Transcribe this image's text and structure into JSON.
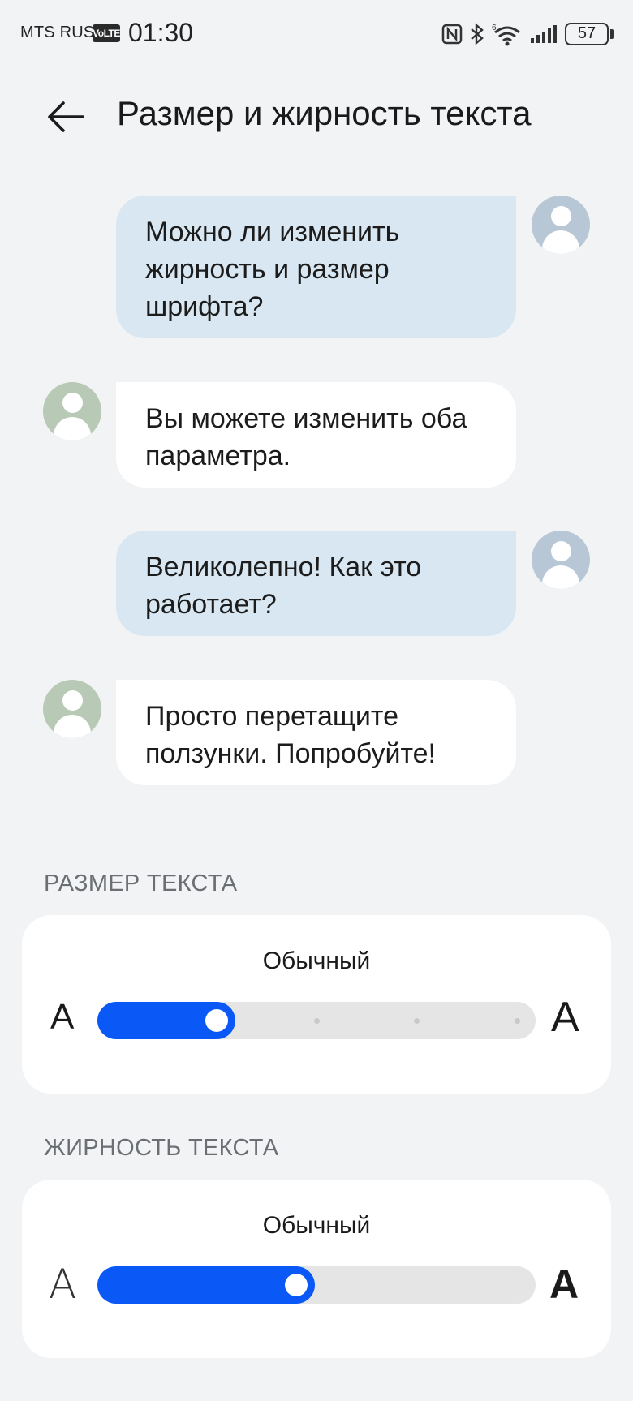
{
  "status_bar": {
    "carrier": "MTS RUS",
    "network_badge": "VoLTE",
    "time": "01:30",
    "battery_level": "57",
    "icons": [
      "nfc-icon",
      "bluetooth-icon",
      "wifi-6-icon",
      "signal-icon",
      "battery-icon"
    ]
  },
  "header": {
    "back_icon": "arrow-left-icon",
    "title": "Размер и жирность текста"
  },
  "chat": [
    {
      "side": "sent",
      "text": "Можно ли изменить жирность и размер шрифта?"
    },
    {
      "side": "received",
      "text": "Вы можете изменить оба параметра."
    },
    {
      "side": "sent",
      "text": "Великолепно! Как это работает?"
    },
    {
      "side": "received",
      "text": "Просто перетащите ползунки. Попробуйте!"
    }
  ],
  "text_size": {
    "label": "РАЗМЕР ТЕКСТА",
    "value": "Обычный",
    "min_glyph": "A",
    "max_glyph": "A",
    "step": 1,
    "steps": 5
  },
  "text_weight": {
    "label": "ЖИРНОСТЬ ТЕКСТА",
    "value": "Обычный",
    "min_glyph": "A",
    "max_glyph": "A",
    "fraction": 0.45
  },
  "colors": {
    "accent": "#0a59f7",
    "sent_bubble": "#d8e7f1",
    "received_bubble": "#ffffff",
    "background": "#f1f3f5"
  }
}
